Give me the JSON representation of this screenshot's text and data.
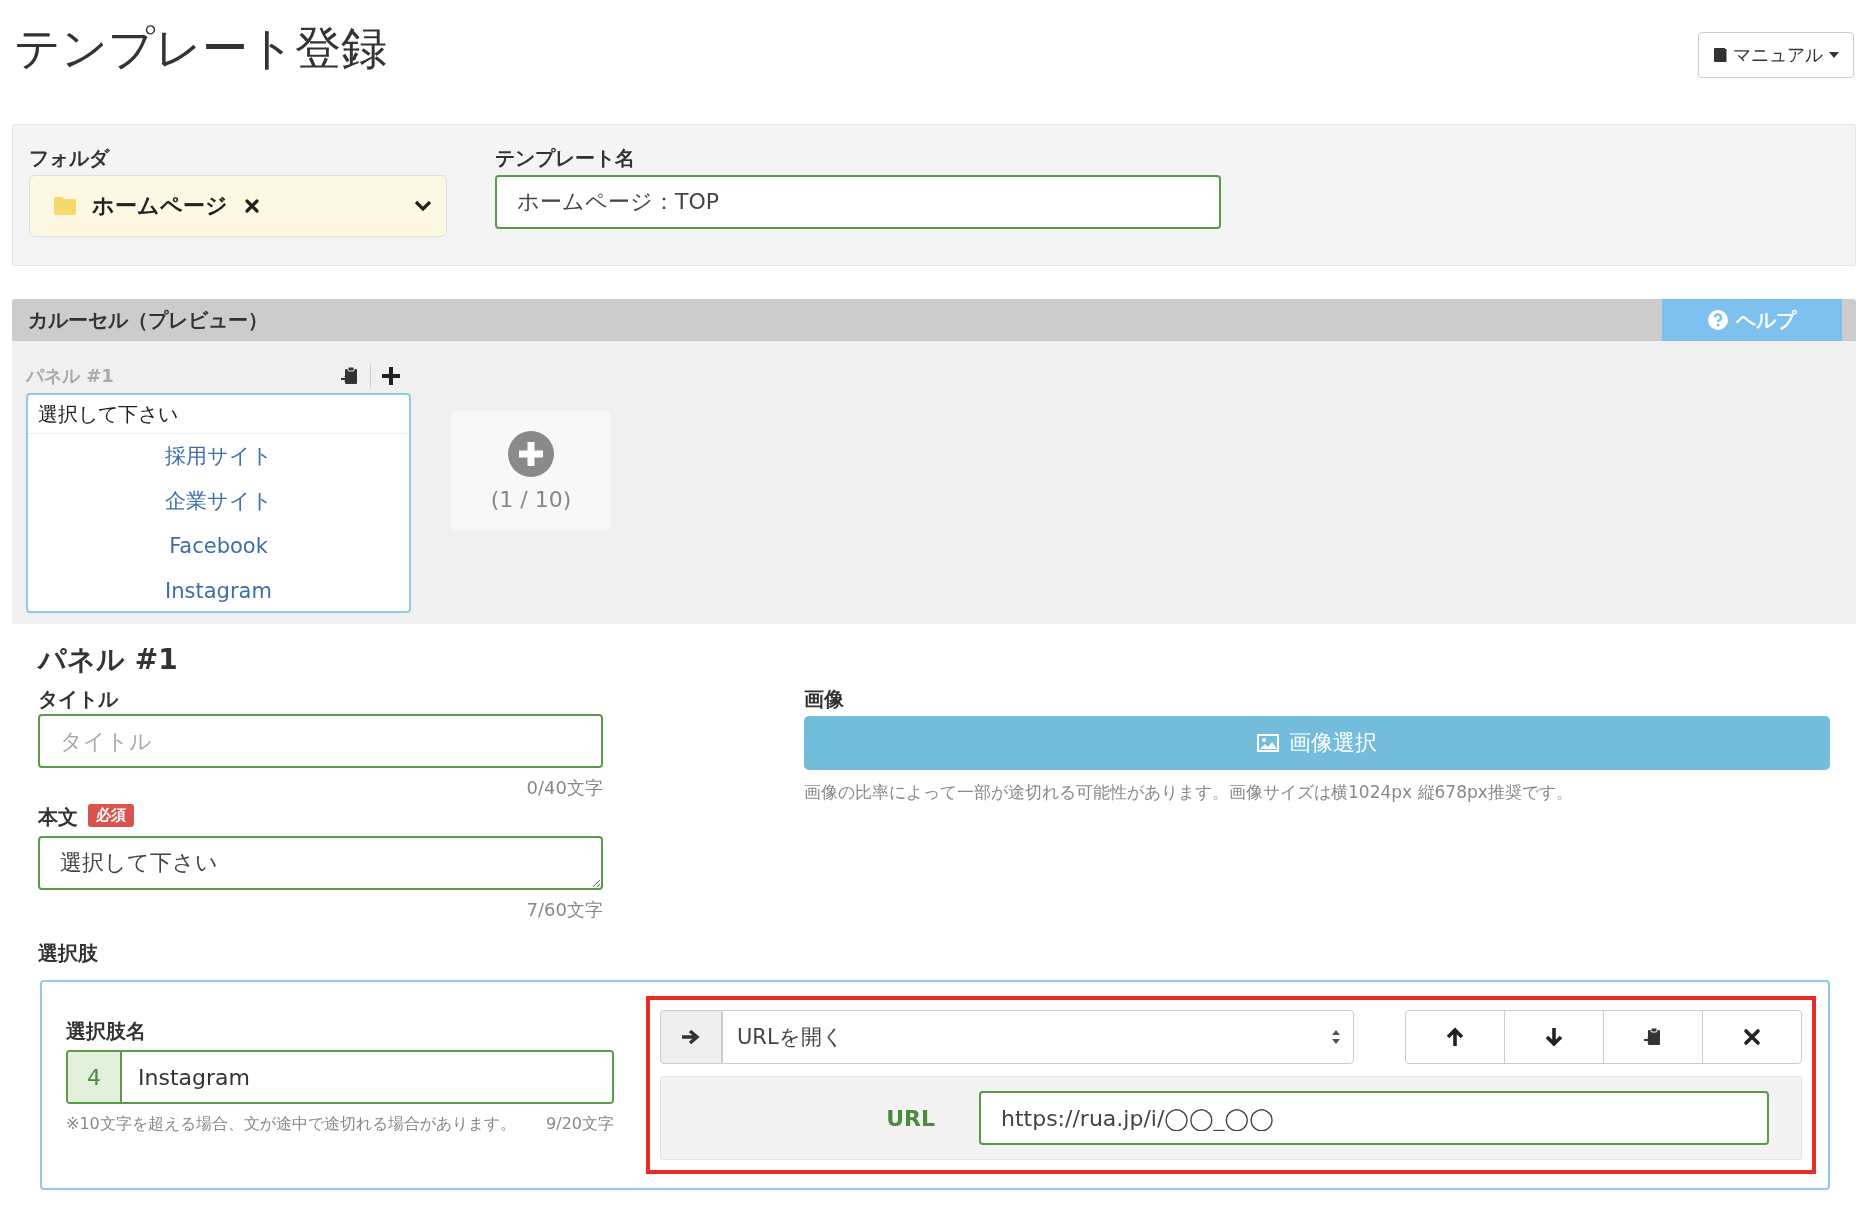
{
  "header": {
    "title": "テンプレート登録",
    "manual_button": "マニュアル"
  },
  "template_settings": {
    "folder_label": "フォルダ",
    "folder_value": "ホームページ",
    "template_name_label": "テンプレート名",
    "template_name_value": "ホームページ：TOP"
  },
  "carousel": {
    "title": "カルーセル（プレビュー）",
    "help_button": "ヘルプ",
    "panel_label": "パネル #1",
    "preview_title": "選択して下さい",
    "preview_choices": [
      "採用サイト",
      "企業サイト",
      "Facebook",
      "Instagram"
    ],
    "panel_count": "(1 / 10)"
  },
  "panel_editor": {
    "heading": "パネル #1",
    "title_label": "タイトル",
    "title_placeholder": "タイトル",
    "title_counter": "0/40文字",
    "body_label": "本文",
    "required_badge": "必須",
    "body_value": "選択して下さい",
    "body_counter": "7/60文字",
    "image_label": "画像",
    "image_button": "画像選択",
    "image_hint": "画像の比率によって一部が途切れる可能性があります。画像サイズは横1024px 縦678px推奨です。",
    "choices_label": "選択肢"
  },
  "choice": {
    "name_label": "選択肢名",
    "number": "4",
    "name_value": "Instagram",
    "name_hint": "※10文字を超える場合、文が途中で途切れる場合があります。",
    "name_counter": "9/20文字",
    "action_value": "URLを開く",
    "url_label": "URL",
    "url_value": "https://rua.jp/i/◯◯_◯◯"
  }
}
